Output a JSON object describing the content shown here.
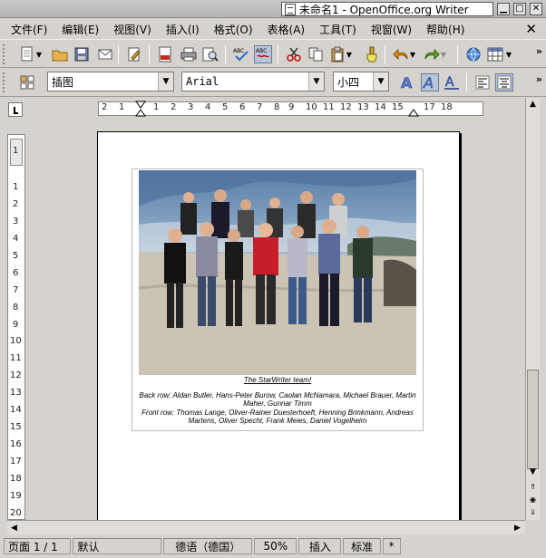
{
  "window": {
    "title": "未命名1 - OpenOffice.org Writer",
    "buttons": {
      "minimize": "▁",
      "maximize": "□",
      "close": "✕"
    }
  },
  "menu": {
    "items": [
      "文件(F)",
      "编辑(E)",
      "视图(V)",
      "插入(I)",
      "格式(O)",
      "表格(A)",
      "工具(T)",
      "视窗(W)",
      "帮助(H)"
    ],
    "close_doc": "✕"
  },
  "toolbar_formatting": {
    "style": "插图",
    "font": "Arial",
    "size": "小四"
  },
  "ruler": {
    "horizontal": [
      "2",
      "1",
      "1",
      "2",
      "3",
      "4",
      "5",
      "6",
      "7",
      "8",
      "9",
      "10",
      "11",
      "12",
      "13",
      "14",
      "15",
      "16",
      "17",
      "18"
    ],
    "vertical": [
      "1",
      "1",
      "2",
      "3",
      "4",
      "5",
      "6",
      "7",
      "8",
      "9",
      "10",
      "11",
      "12",
      "13",
      "14",
      "15",
      "16",
      "17",
      "18",
      "19",
      "20"
    ]
  },
  "document": {
    "caption_title": "The StarWriter team!",
    "caption_back": "Back row: Aldan Butler, Hans-Peter Burow, Caolan McNamara, Michael Brauer, Martin Maher, Gunnar Timm",
    "caption_front": "Front row: Thomas Lange, Oliver-Rainer Duesterhoeft, Henning Brinkmann, Andreas Martens, Oliver Specht, Frank Meies, Daniel Vogelheim"
  },
  "status": {
    "page": "页面 1 / 1",
    "style": "默认",
    "language": "德语（德国）",
    "zoom": "50%",
    "mode": "插入",
    "selection": "标准",
    "modified": "*"
  }
}
